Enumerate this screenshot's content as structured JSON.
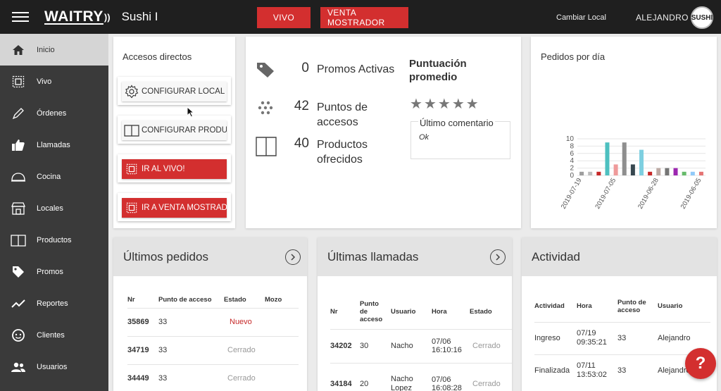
{
  "header": {
    "logo": "WAITRY",
    "store_name": "Sushi I",
    "btn_vivo": "VIVO",
    "btn_venta": "VENTA MOSTRADOR",
    "cambiar_local": "Cambiar Local",
    "user": "ALEJANDRO",
    "avatar_text": "SUSHI"
  },
  "sidebar": {
    "items": [
      {
        "label": "Inicio",
        "icon": "home-icon"
      },
      {
        "label": "Vivo",
        "icon": "live-icon"
      },
      {
        "label": "Órdenes",
        "icon": "pencil-icon"
      },
      {
        "label": "Llamadas",
        "icon": "thumbs-up-icon"
      },
      {
        "label": "Cocina",
        "icon": "cloche-icon"
      },
      {
        "label": "Locales",
        "icon": "store-icon"
      },
      {
        "label": "Productos",
        "icon": "book-icon"
      },
      {
        "label": "Promos",
        "icon": "tag-icon"
      },
      {
        "label": "Reportes",
        "icon": "trend-icon"
      },
      {
        "label": "Clientes",
        "icon": "face-icon"
      },
      {
        "label": "Usuarios",
        "icon": "users-icon"
      }
    ]
  },
  "accesos": {
    "title": "Accesos directos",
    "items": [
      "CONFIGURAR LOCAL",
      "CONFIGURAR PRODUCTOS",
      "IR AL VIVO!",
      "IR A VENTA MOSTRADOR"
    ]
  },
  "stats": {
    "promos_num": "0",
    "promos_label": "Promos Activas",
    "puntos_num": "42",
    "puntos_label": "Puntos de accesos",
    "productos_num": "40",
    "productos_label": "Productos ofrecidos",
    "puntuacion_title": "Puntuación promedio",
    "stars": 5,
    "comentario_title": "Último comentario",
    "comentario_val": "Ok"
  },
  "pedidos_dia": {
    "title": "Pedidos por día"
  },
  "chart_data": {
    "type": "bar",
    "title": "Pedidos por día",
    "ylim": [
      0,
      10
    ],
    "yticks": [
      "0",
      "2",
      "4",
      "6",
      "8",
      "10"
    ],
    "x_tick_labels": [
      "2019-07-19",
      "2019-07-05",
      "2019-06-28",
      "2019-06-05"
    ],
    "values": [
      1,
      1,
      1,
      9,
      3,
      9,
      3,
      7,
      1,
      2,
      2,
      2,
      1,
      1,
      1
    ],
    "colors": [
      "#9e9e9e",
      "#bdbdbd",
      "#c62828",
      "#4dc0c0",
      "#ef9a9a",
      "#8e8e8e",
      "#37474f",
      "#7ecfe0",
      "#c62828",
      "#bcaaa4",
      "#757575",
      "#9c27b0",
      "#66bb6a",
      "#90caf9",
      "#e57373"
    ]
  },
  "ultimos_pedidos": {
    "title": "Últimos pedidos",
    "columns": [
      "Nr",
      "Punto de acceso",
      "Estado",
      "Mozo"
    ],
    "rows": [
      {
        "nr": "35869",
        "punto": "33",
        "estado": "Nuevo",
        "mozo": ""
      },
      {
        "nr": "34719",
        "punto": "33",
        "estado": "Cerrado",
        "mozo": ""
      },
      {
        "nr": "34449",
        "punto": "33",
        "estado": "Cerrado",
        "mozo": ""
      }
    ]
  },
  "ultimas_llamadas": {
    "title": "Últimas llamadas",
    "columns": [
      "Nr",
      "Punto de acceso",
      "Usuario",
      "Hora",
      "Estado"
    ],
    "rows": [
      {
        "nr": "34202",
        "punto": "30",
        "usuario": "Nacho",
        "hora": "07/06 16:10:16",
        "estado": "Cerrado"
      },
      {
        "nr": "34184",
        "punto": "20",
        "usuario": "Nacho Lopez",
        "hora": "07/06 16:08:28",
        "estado": "Cerrado"
      }
    ]
  },
  "actividad": {
    "title": "Actividad",
    "columns": [
      "Actividad",
      "Hora",
      "Punto de acceso",
      "Usuario"
    ],
    "rows": [
      {
        "actividad": "Ingreso",
        "hora": "07/19 09:35:21",
        "punto": "33",
        "usuario": "Alejandro"
      },
      {
        "actividad": "Finalizada",
        "hora": "07/11 13:53:02",
        "punto": "33",
        "usuario": "Alejandro"
      }
    ]
  },
  "help": "?",
  "colors": {
    "accent": "#d32f2f",
    "topbar": "#1f1f1f",
    "sidebar": "#3a3a3a"
  }
}
